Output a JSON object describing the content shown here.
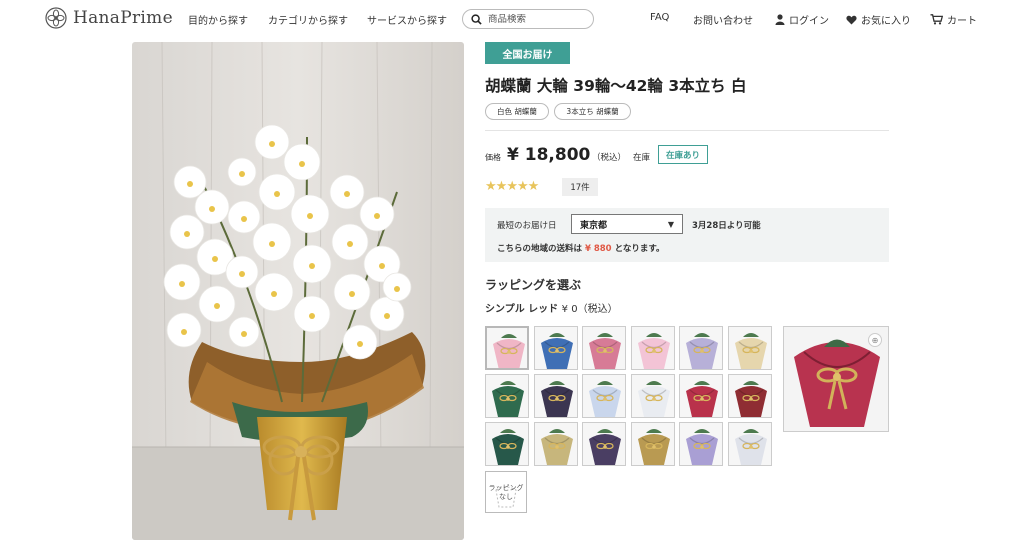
{
  "header": {
    "brand": "HanaPrime",
    "nav": [
      "目的から探す",
      "カテゴリから探す",
      "サービスから探す"
    ],
    "search_placeholder": "商品検索",
    "faq": "FAQ",
    "contact": "お問い合わせ",
    "login": "ログイン",
    "favorites": "お気に入り",
    "cart": "カート"
  },
  "product": {
    "badge": "全国お届け",
    "title": "胡蝶蘭 大輪 39輪〜42輪 3本立ち 白",
    "tags": [
      "白色 胡蝶蘭",
      "3本立ち 胡蝶蘭"
    ],
    "price_label": "価格",
    "price": "¥ 18,800",
    "tax_note": "（税込）",
    "stock_label": "在庫",
    "stock_status": "在庫あり",
    "rating": 5,
    "review_count": "17件"
  },
  "delivery": {
    "label": "最短のお届け日",
    "region": "東京都",
    "available": "3月28日より可能",
    "fee_prefix": "こちらの地域の送料は",
    "fee": "¥ 880",
    "fee_suffix": "となります。"
  },
  "wrapping": {
    "heading": "ラッピングを選ぶ",
    "selected_name": "シンプル レッド",
    "selected_price": "¥ 0（税込）",
    "no_wrap_line1": "ラッピング",
    "no_wrap_line2": "なし",
    "swatches": [
      {
        "name": "pink",
        "color": "#f0b6c6"
      },
      {
        "name": "blue",
        "color": "#3f6fb5"
      },
      {
        "name": "rose",
        "color": "#d77b96"
      },
      {
        "name": "light-pink",
        "color": "#f3c4d6"
      },
      {
        "name": "lavender",
        "color": "#b7b0d8"
      },
      {
        "name": "cream",
        "color": "#e6d6ad"
      },
      {
        "name": "green",
        "color": "#2f6b4e"
      },
      {
        "name": "navy-gold",
        "color": "#3b3551"
      },
      {
        "name": "white-blue",
        "color": "#c9d6ec"
      },
      {
        "name": "white",
        "color": "#e9ecf1"
      },
      {
        "name": "red",
        "color": "#b9324b"
      },
      {
        "name": "dark-red",
        "color": "#8f2d33"
      },
      {
        "name": "dark-green",
        "color": "#27584a"
      },
      {
        "name": "gold-stripe",
        "color": "#c7b67c"
      },
      {
        "name": "purple-gold",
        "color": "#4a3e63"
      },
      {
        "name": "gold",
        "color": "#b99a52"
      },
      {
        "name": "lilac",
        "color": "#a99fd4"
      },
      {
        "name": "silver",
        "color": "#dfe2ea"
      }
    ],
    "preview_color": "#b8334f"
  },
  "colors": {
    "accent": "#3f9f95",
    "fee": "#e05a47",
    "star": "#e8c45c"
  }
}
